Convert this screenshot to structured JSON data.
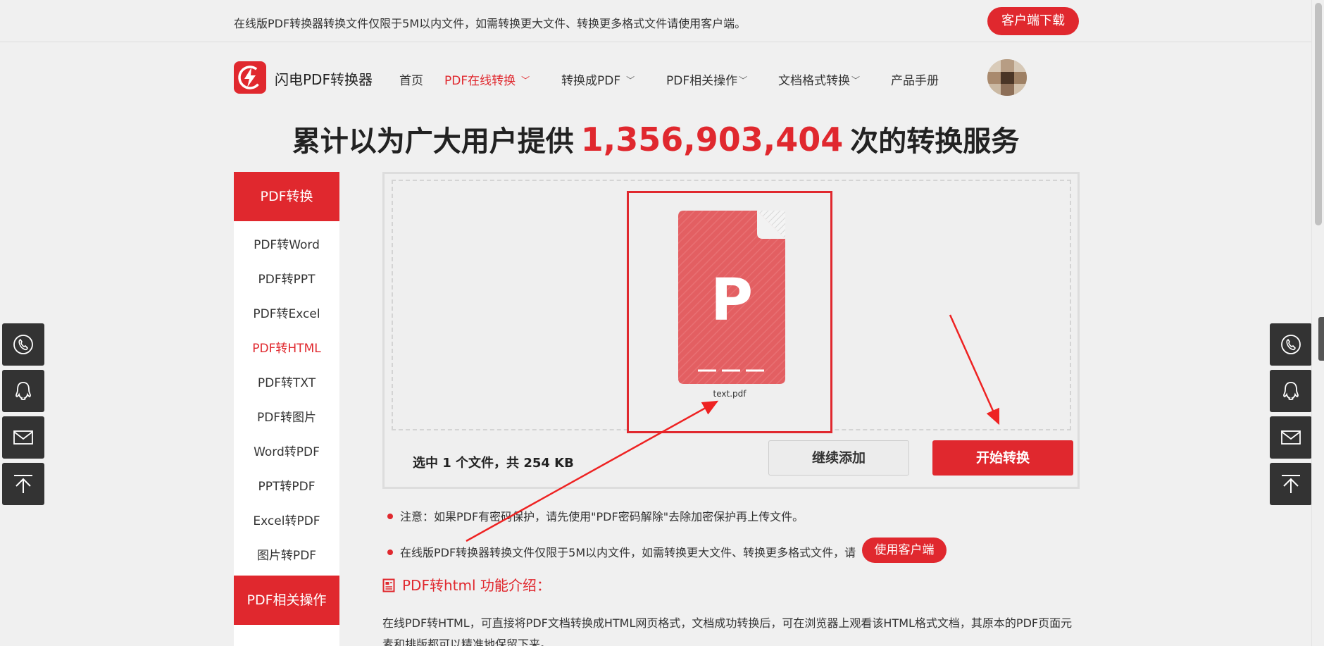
{
  "topbar": {
    "notice": "在线版PDF转换器转换文件仅限于5M以内文件，如需转换更大文件、转换更多格式文件请使用客户端。",
    "download_label": "客户端下载"
  },
  "header": {
    "brand": "闪电PDF转换器",
    "nav": [
      {
        "label": "首页"
      },
      {
        "label": "PDF在线转换"
      },
      {
        "label": "转换成PDF"
      },
      {
        "label": "PDF相关操作"
      },
      {
        "label": "文档格式转换"
      },
      {
        "label": "产品手册"
      }
    ]
  },
  "headline": {
    "prefix": "累计以为广大用户提供",
    "count": "1,356,903,404",
    "suffix": "次的转换服务"
  },
  "sidebar": {
    "section1": "PDF转换",
    "items": [
      {
        "label": "PDF转Word"
      },
      {
        "label": "PDF转PPT"
      },
      {
        "label": "PDF转Excel"
      },
      {
        "label": "PDF转HTML"
      },
      {
        "label": "PDF转TXT"
      },
      {
        "label": "PDF转图片"
      },
      {
        "label": "Word转PDF"
      },
      {
        "label": "PPT转PDF"
      },
      {
        "label": "Excel转PDF"
      },
      {
        "label": "图片转PDF"
      }
    ],
    "active_index": 3,
    "section2": "PDF相关操作"
  },
  "upload": {
    "file_letter": "P",
    "file_name": "text.pdf",
    "summary": "选中 1 个文件，共 254 KB",
    "add_label": "继续添加",
    "start_label": "开始转换"
  },
  "notes": {
    "note1": "注意：如果PDF有密码保护，请先使用\"PDF密码解除\"去除加密保护再上传文件。",
    "note2": "在线版PDF转换器转换文件仅限于5M以内文件，如需转换更大文件、转换更多格式文件，请",
    "client_label": "使用客户端"
  },
  "intro": {
    "title": "PDF转html 功能介绍：",
    "text": "在线PDF转HTML，可直接将PDF文档转换成HTML网页格式，文档成功转换后，可在浏览器上观看该HTML格式文档，其原本的PDF页面元素和排版都可以精准地保留下来。"
  },
  "colors": {
    "accent": "#e0282e",
    "page_bg": "#f0f0f0",
    "float_bg": "#333333"
  },
  "float_icons": [
    "phone-icon",
    "qq-icon",
    "mail-icon",
    "back-to-top-icon"
  ]
}
